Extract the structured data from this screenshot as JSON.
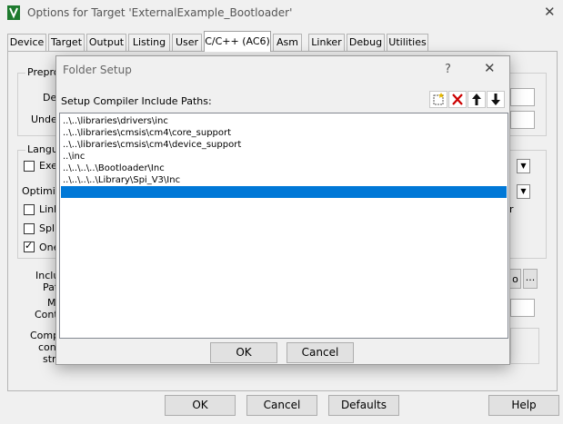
{
  "window": {
    "title": "Options for Target 'ExternalExample_Bootloader'",
    "close_glyph": "✕"
  },
  "tabs": [
    {
      "label": "Device"
    },
    {
      "label": "Target"
    },
    {
      "label": "Output"
    },
    {
      "label": "Listing"
    },
    {
      "label": "User"
    },
    {
      "label": "C/C++ (AC6)",
      "active": true
    },
    {
      "label": "Asm"
    },
    {
      "label": "Linker"
    },
    {
      "label": "Debug"
    },
    {
      "label": "Utilities"
    }
  ],
  "background": {
    "preprocessor_group_label": "Prepro",
    "define_label": "Def",
    "undefine_label": "Unde",
    "language_group_label": "Langu",
    "execute_only_label": "Exe",
    "optimize_label": "Optimiz",
    "link_label": "Link",
    "split_label": "Spli",
    "one_label": "One",
    "one_checked": true,
    "right_edge_letter": "r",
    "include_label": "Inclu",
    "paths_label": "Pat",
    "misc_label": "M",
    "controls_label": "Contr",
    "compiler_label": "Comp",
    "control_label": "cont",
    "string_label": "stri",
    "browse_partial": "o",
    "ellipsis_label": "..."
  },
  "bottom_buttons": {
    "ok": "OK",
    "cancel": "Cancel",
    "defaults": "Defaults",
    "help": "Help"
  },
  "dialog": {
    "title": "Folder Setup",
    "help_glyph": "?",
    "close_glyph": "✕",
    "list_label": "Setup Compiler Include Paths:",
    "toolbar": {
      "new_icon": "new-folder-icon",
      "delete_icon": "delete-icon",
      "move_up_icon": "move-up-icon",
      "move_down_icon": "move-down-icon"
    },
    "paths": [
      "..\\..\\libraries\\drivers\\inc",
      "..\\..\\libraries\\cmsis\\cm4\\core_support",
      "..\\..\\libraries\\cmsis\\cm4\\device_support",
      "..\\inc",
      "..\\..\\..\\..\\Bootloader\\Inc",
      "..\\..\\..\\..\\Library\\Spi_V3\\Inc"
    ],
    "selected_row_index": 6,
    "ok": "OK",
    "cancel": "Cancel",
    "colors": {
      "selection": "#0078d7",
      "delete_red": "#cc0000"
    }
  }
}
